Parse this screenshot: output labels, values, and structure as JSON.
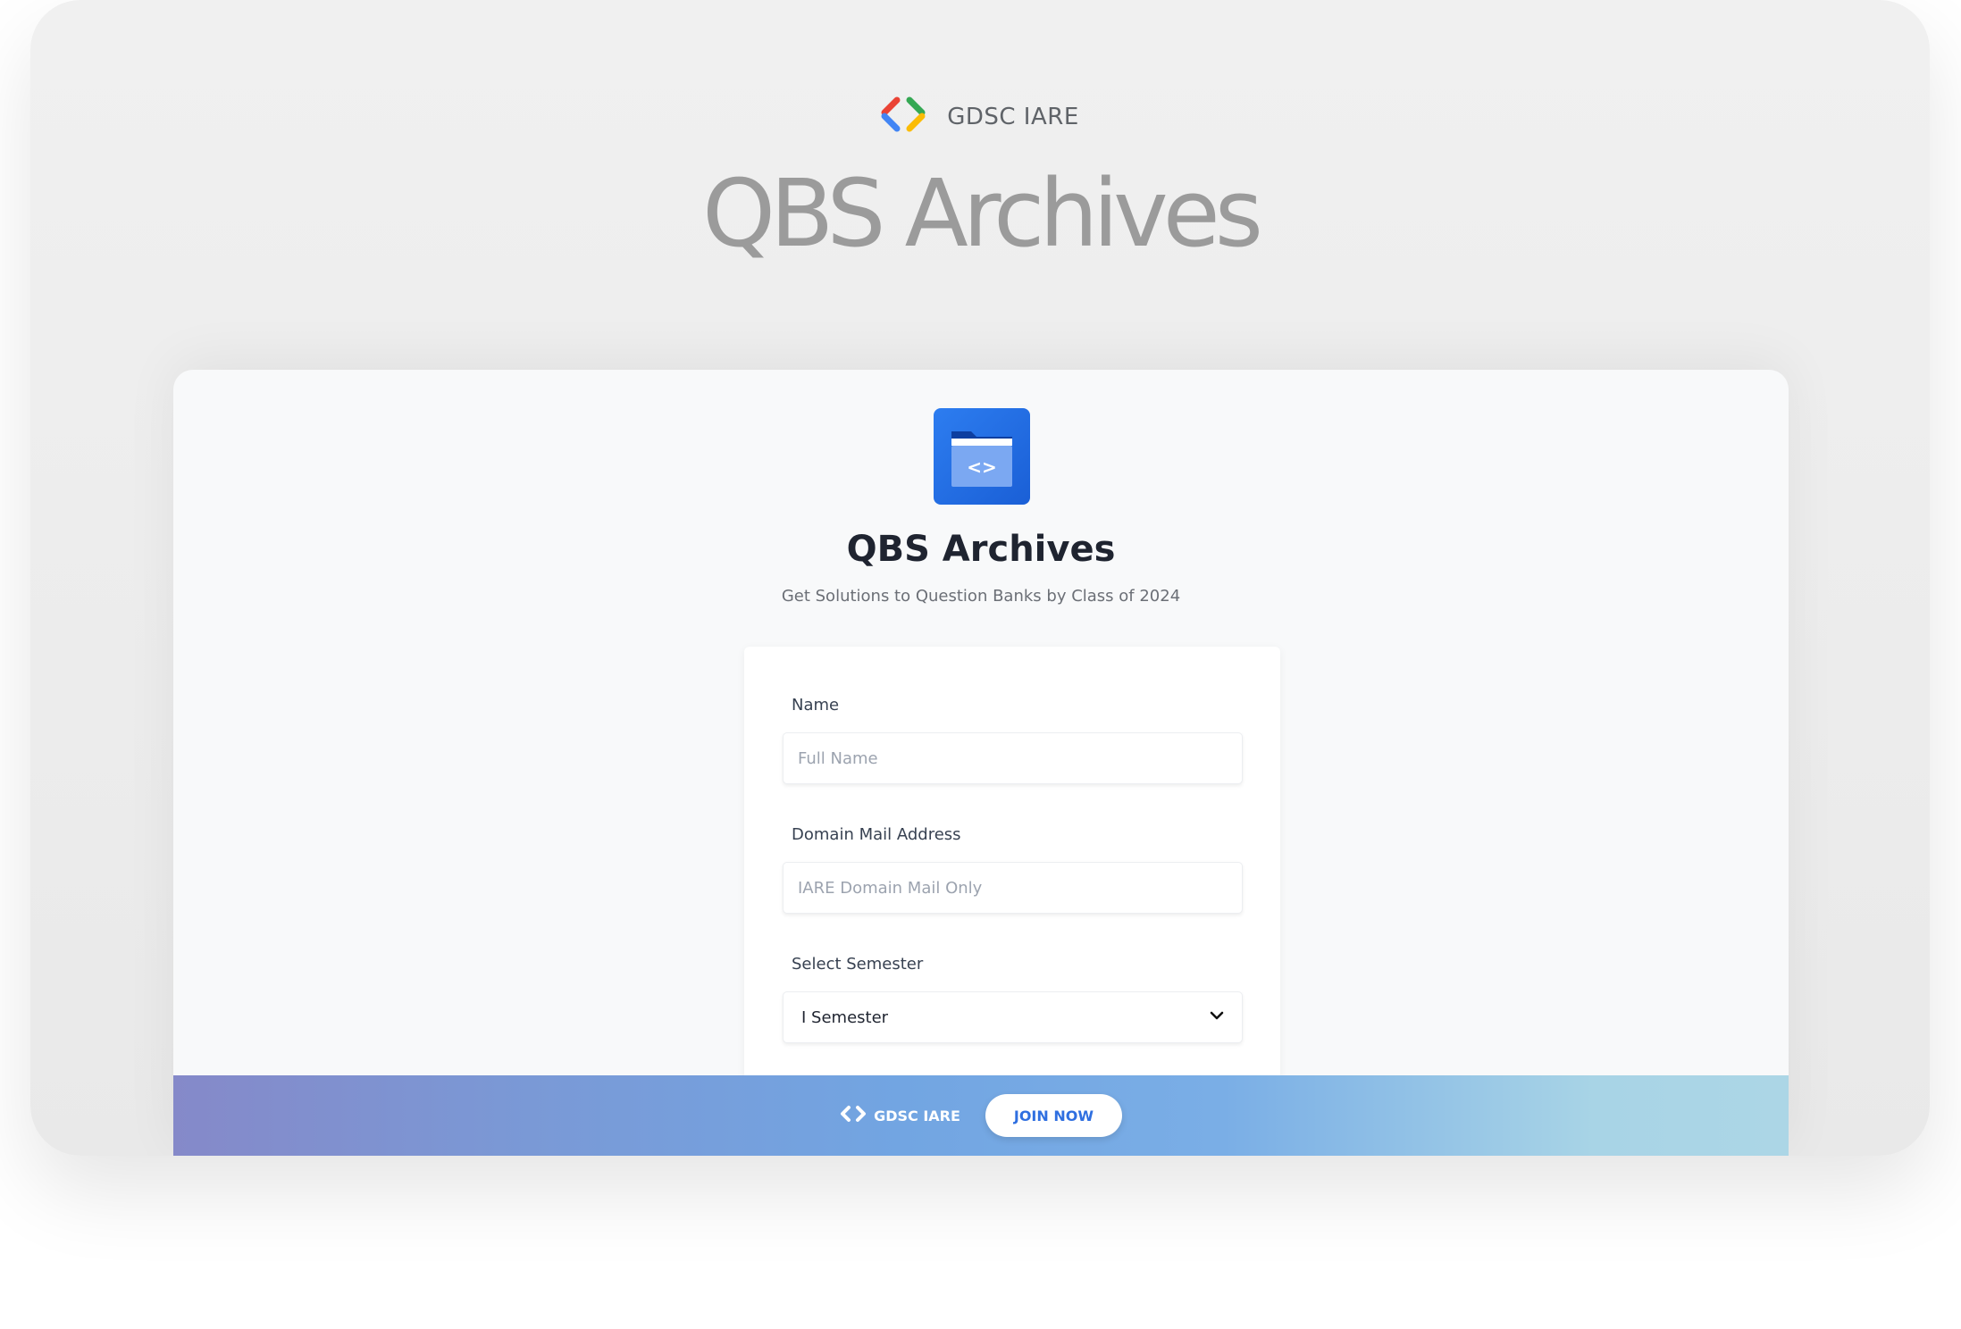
{
  "brand": {
    "name": "GDSC IARE"
  },
  "hero": {
    "title": "QBS Archives"
  },
  "app": {
    "title": "QBS Archives",
    "subtitle": "Get Solutions to Question Banks by Class of 2024"
  },
  "form": {
    "name_label": "Name",
    "name_placeholder": "Full Name",
    "name_value": "",
    "email_label": "Domain Mail Address",
    "email_placeholder": "IARE Domain Mail Only",
    "email_value": "",
    "semester_label": "Select Semester",
    "semester_selected": "I Semester"
  },
  "footer": {
    "brand_name": "GDSC IARE",
    "join_label": "JOIN NOW"
  },
  "colors": {
    "primary_blue": "#2f6fe0",
    "logo_blue": "#1a5fd6",
    "google_red": "#ea4335",
    "google_blue": "#4285f4",
    "google_green": "#34a853",
    "google_yellow": "#fbbc05"
  },
  "icons": {
    "brand_logo": "gdsc-brackets-icon",
    "app_logo": "code-folder-icon",
    "select_chevron": "chevron-down-icon",
    "footer_logo": "gdsc-brackets-icon"
  }
}
